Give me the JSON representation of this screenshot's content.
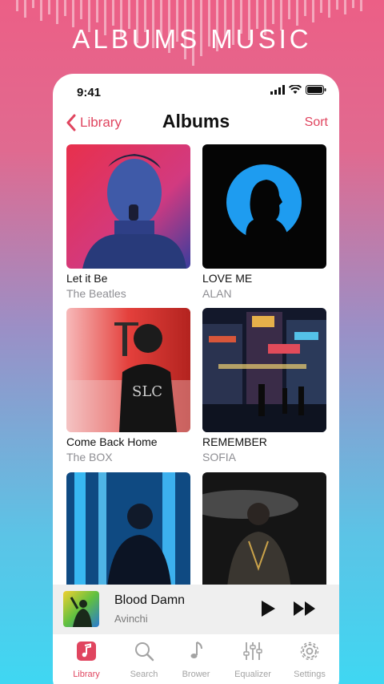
{
  "headline": "ALBUMS MUSIC",
  "status": {
    "time": "9:41"
  },
  "nav": {
    "back_label": "Library",
    "title": "Albums",
    "sort_label": "Sort"
  },
  "albums": [
    {
      "title": "Let it Be",
      "artist": "The Beatles"
    },
    {
      "title": "LOVE ME",
      "artist": "ALAN"
    },
    {
      "title": "Come Back Home",
      "artist": "The BOX"
    },
    {
      "title": "REMEMBER",
      "artist": "SOFIA"
    },
    {
      "title": "",
      "artist": ""
    },
    {
      "title": "",
      "artist": ""
    }
  ],
  "now_playing": {
    "title": "Blood Damn",
    "artist": "Avinchi"
  },
  "tabs": [
    {
      "label": "Library",
      "icon": "music-note-icon",
      "active": true
    },
    {
      "label": "Search",
      "icon": "search-icon",
      "active": false
    },
    {
      "label": "Brower",
      "icon": "note-icon",
      "active": false
    },
    {
      "label": "Equalizer",
      "icon": "equalizer-icon",
      "active": false
    },
    {
      "label": "Settings",
      "icon": "gear-icon",
      "active": false
    }
  ],
  "colors": {
    "accent": "#e0455f",
    "bg_top": "#ec5f86",
    "bg_bottom": "#3fd7f2"
  }
}
